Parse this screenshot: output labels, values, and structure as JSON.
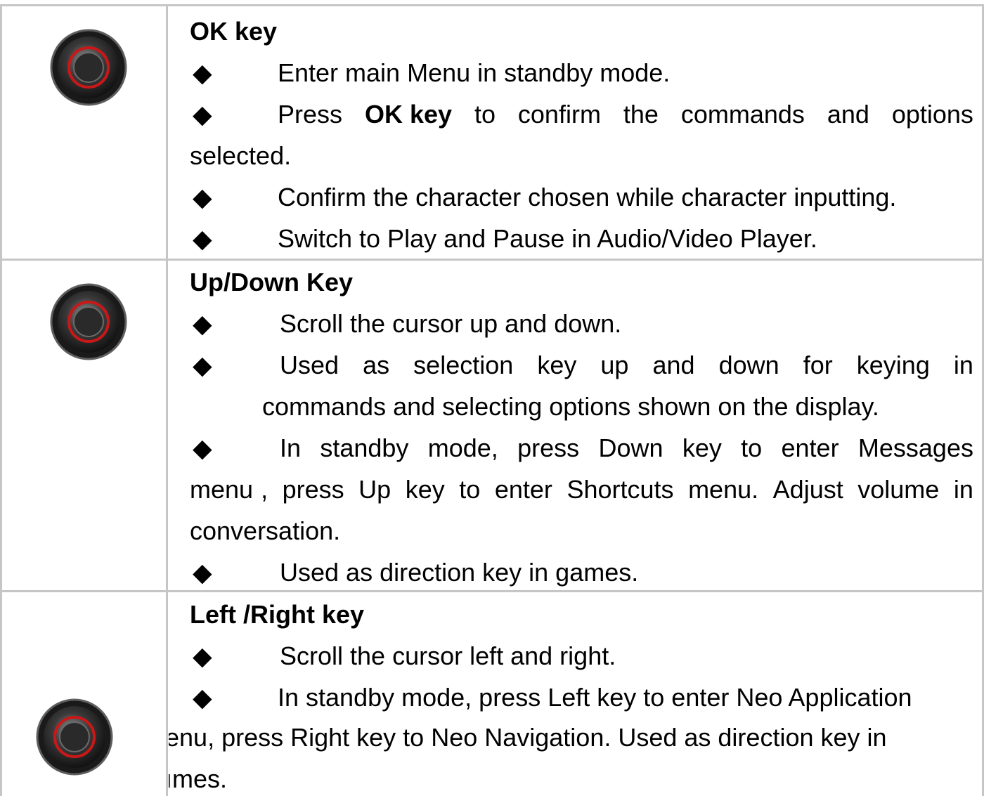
{
  "sections": [
    {
      "title": "OK key",
      "bullets": {
        "b1": "Enter main Menu in standby mode.",
        "b2_pre": "Press",
        "b2_bold": "OK key",
        "b2_words": [
          "to",
          "confirm",
          "the",
          "commands",
          "and",
          "options"
        ],
        "b2_cont": "selected.",
        "b3": "Confirm the character chosen while character inputting.",
        "b4": "Switch to Play and Pause in Audio/Video Player."
      }
    },
    {
      "title": "Up/Down Key",
      "bullets": {
        "b1": "Scroll the cursor up and down.",
        "b2_words": [
          "Used",
          "as",
          "selection",
          "key",
          "up",
          "and",
          "down",
          "for",
          "keying",
          "in"
        ],
        "b2_cont": "commands and selecting options shown on the display.",
        "b3_words": [
          "In",
          "standby",
          "mode,",
          "press",
          "Down",
          "key",
          "to",
          "enter",
          "Messages"
        ],
        "b3_line2_words": [
          "menu",
          ",",
          "press",
          "Up",
          "key",
          "to",
          "enter",
          "Shortcuts",
          "menu.",
          "Adjust",
          "volume",
          "in"
        ],
        "b3_line3": "conversation.",
        "b4": "Used as direction key in games."
      }
    },
    {
      "title": "Left /Right key",
      "bullets": {
        "b1": "Scroll the cursor left and right.",
        "b2": "In standby mode, press Left key to enter Neo Application",
        "b2_line2": "enu, press Right key to Neo Navigation.   Used as direction key in",
        "b2_line3": "ımes."
      }
    }
  ],
  "bullet_symbol": "◆",
  "icons": [
    "navigation-key-icon",
    "navigation-key-icon",
    "navigation-key-icon"
  ]
}
